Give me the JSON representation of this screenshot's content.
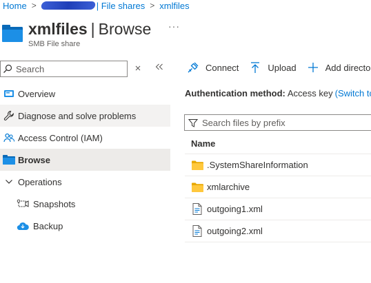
{
  "breadcrumb": {
    "home": "Home",
    "file_shares": "File shares",
    "current": "xmlfiles"
  },
  "header": {
    "title_bold": "xmlfiles",
    "title_rest": "Browse",
    "subtitle": "SMB File share",
    "more": "···"
  },
  "sidebar": {
    "search_placeholder": "Search",
    "items": [
      {
        "label": "Overview",
        "icon": "overview-icon"
      },
      {
        "label": "Diagnose and solve problems",
        "icon": "wrench-icon"
      },
      {
        "label": "Access Control (IAM)",
        "icon": "people-icon"
      },
      {
        "label": "Browse",
        "icon": "folder-icon"
      },
      {
        "label": "Operations",
        "icon": "chevron-down-icon"
      },
      {
        "label": "Snapshots",
        "icon": "snapshots-icon"
      },
      {
        "label": "Backup",
        "icon": "backup-cloud-icon"
      }
    ]
  },
  "toolbar": {
    "connect": "Connect",
    "upload": "Upload",
    "add_directory": "Add director"
  },
  "auth": {
    "label": "Authentication method:",
    "value": "Access key",
    "link": "(Switch to"
  },
  "filter": {
    "placeholder": "Search files by prefix"
  },
  "table": {
    "header": "Name",
    "rows": [
      {
        "name": ".SystemShareInformation",
        "type": "folder"
      },
      {
        "name": "xmlarchive",
        "type": "folder"
      },
      {
        "name": "outgoing1.xml",
        "type": "file"
      },
      {
        "name": "outgoing2.xml",
        "type": "file"
      }
    ]
  },
  "colors": {
    "accent": "#0078d4",
    "folder": "#ffc83d",
    "nav_active": "#edebe9"
  }
}
